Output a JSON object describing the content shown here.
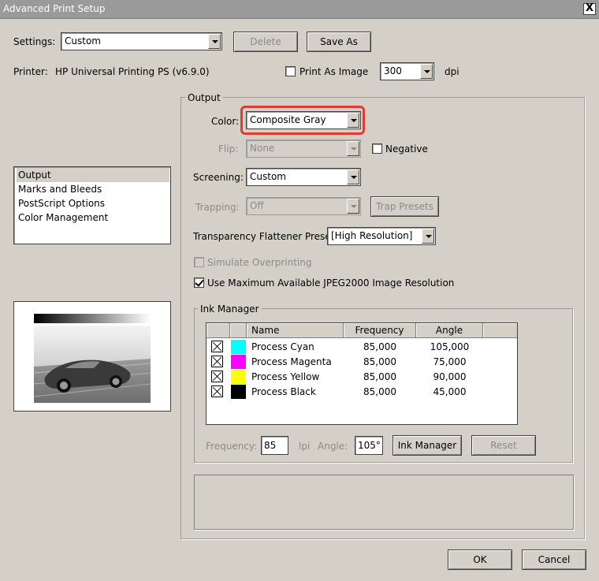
{
  "window": {
    "title": "Advanced Print Setup",
    "close": "X"
  },
  "settings": {
    "label": "Settings:",
    "value": "Custom",
    "delete_label": "Delete",
    "save_as_label": "Save As"
  },
  "printer": {
    "label": "Printer:",
    "value": "HP Universal Printing PS (v6.9.0)",
    "print_as_image_label": "Print As Image",
    "print_as_image_checked": false,
    "dpi_value": "300",
    "dpi_unit": "dpi"
  },
  "sidebar": {
    "items": [
      {
        "label": "Output",
        "selected": true
      },
      {
        "label": "Marks and Bleeds"
      },
      {
        "label": "PostScript Options"
      },
      {
        "label": "Color Management"
      }
    ]
  },
  "output": {
    "group_title": "Output",
    "color_label": "Color:",
    "color_value": "Composite Gray",
    "flip_label": "Flip:",
    "flip_value": "None",
    "negative_label": "Negative",
    "negative_checked": false,
    "screening_label": "Screening:",
    "screening_value": "Custom",
    "trapping_label": "Trapping:",
    "trapping_value": "Off",
    "trap_presets_label": "Trap Presets",
    "flattener_label": "Transparency Flattener Preset:",
    "flattener_value": "[High Resolution]",
    "simulate_label": "Simulate Overprinting",
    "simulate_checked": false,
    "jpeg_label": "Use Maximum Available JPEG2000 Image Resolution",
    "jpeg_checked": true
  },
  "ink_manager": {
    "group_title": "Ink Manager",
    "columns": [
      "Name",
      "Frequency",
      "Angle"
    ],
    "rows": [
      {
        "name": "Process Cyan",
        "frequency": "85,000",
        "angle": "105,000",
        "color": "#00ffff"
      },
      {
        "name": "Process Magenta",
        "frequency": "85,000",
        "angle": "75,000",
        "color": "#ff00ff"
      },
      {
        "name": "Process Yellow",
        "frequency": "85,000",
        "angle": "90,000",
        "color": "#ffff00"
      },
      {
        "name": "Process Black",
        "frequency": "85,000",
        "angle": "45,000",
        "color": "#000000"
      }
    ],
    "frequency_label": "Frequency:",
    "frequency_value": "85",
    "lpi_label": "lpi",
    "angle_label": "Angle:",
    "angle_value": "105°",
    "ink_manager_button": "Ink Manager",
    "reset_button": "Reset"
  },
  "footer": {
    "ok_label": "OK",
    "cancel_label": "Cancel"
  },
  "colors": {
    "highlight": "#e23b2f",
    "dialog_bg": "#d4d0c8"
  }
}
